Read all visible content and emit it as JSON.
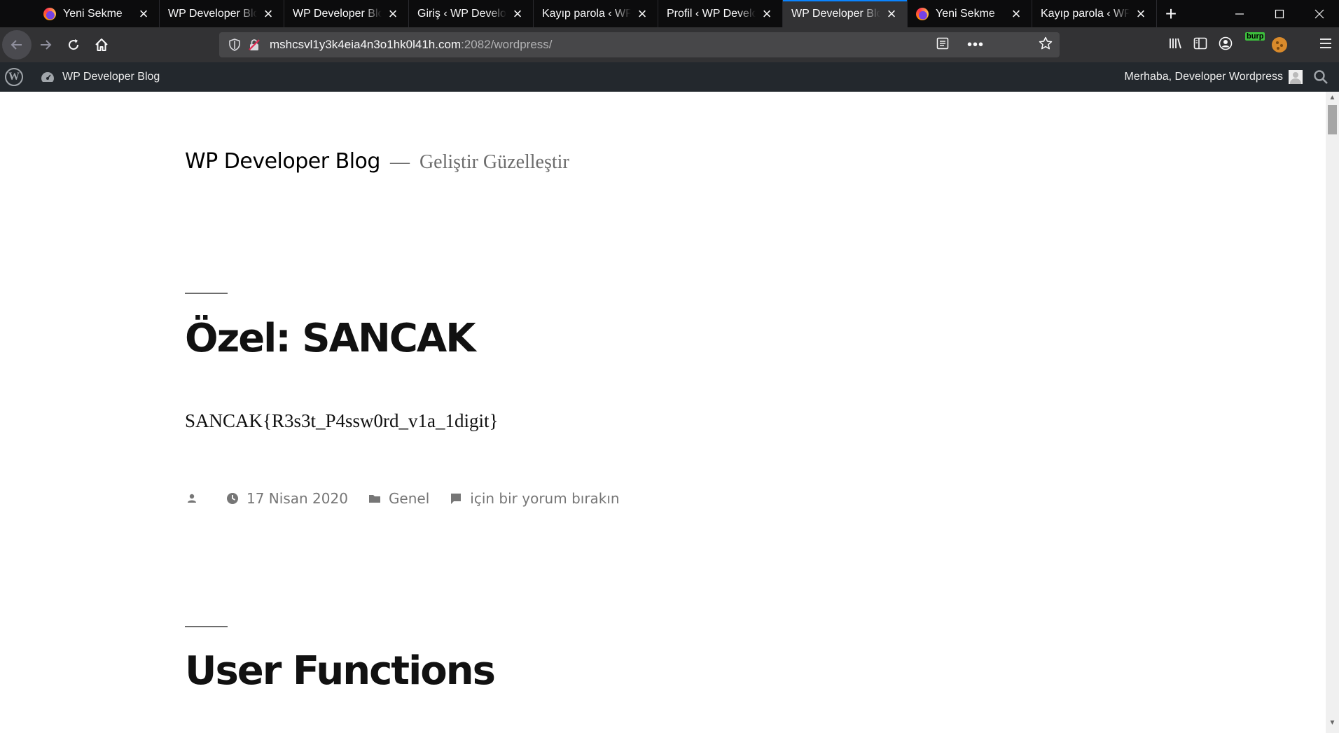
{
  "browser": {
    "tabs": [
      {
        "title": "Yeni Sekme",
        "favicon": "firefox-icon",
        "active": false
      },
      {
        "title": "WP Developer Blog",
        "favicon": "",
        "active": false
      },
      {
        "title": "WP Developer Blog",
        "favicon": "",
        "active": false
      },
      {
        "title": "Giriş ‹ WP Developer",
        "favicon": "",
        "active": false
      },
      {
        "title": "Kayıp parola ‹ WP Developer",
        "favicon": "",
        "active": false
      },
      {
        "title": "Profil ‹ WP Developer",
        "favicon": "",
        "active": false
      },
      {
        "title": "WP Developer Blog",
        "favicon": "",
        "active": true
      },
      {
        "title": "Yeni Sekme",
        "favicon": "firefox-icon",
        "active": false
      },
      {
        "title": "Kayıp parola ‹ WP Developer",
        "favicon": "",
        "active": false
      }
    ],
    "url_host": "mshcsvl1y3k4eia4n3o1hk0l41h.com",
    "url_rest": ":2082/wordpress/",
    "extension_badge": "burp"
  },
  "adminbar": {
    "site_name": "WP Developer Blog",
    "howdy": "Merhaba, Developer Wordpress"
  },
  "site": {
    "title": "WP Developer Blog",
    "dash": "—",
    "description": "Geliştir Güzelleştir"
  },
  "posts": [
    {
      "title": "Özel: SANCAK",
      "content": "SANCAK{R3s3t_P4ssw0rd_v1a_1digit}",
      "date": "17 Nisan 2020",
      "category": "Genel",
      "comment": "için bir yorum bırakın"
    },
    {
      "title": "User Functions"
    }
  ],
  "colors": {
    "tabstrip": "#0c0c0d",
    "toolbar": "#323234",
    "adminbar": "#23282d",
    "accent": "#0a84ff"
  }
}
